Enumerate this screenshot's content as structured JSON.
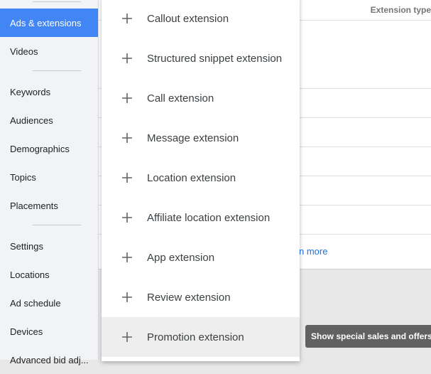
{
  "sidebar": {
    "items": [
      {
        "label": "Ads & extensions",
        "active": true
      },
      {
        "label": "Videos"
      },
      {
        "label": "Keywords"
      },
      {
        "label": "Audiences"
      },
      {
        "label": "Demographics"
      },
      {
        "label": "Topics"
      },
      {
        "label": "Placements"
      },
      {
        "label": "Settings"
      },
      {
        "label": "Locations"
      },
      {
        "label": "Ad schedule"
      },
      {
        "label": "Devices"
      },
      {
        "label": "Advanced bid adj..."
      }
    ]
  },
  "main": {
    "column_header": "Extension type",
    "learn_more": "n more"
  },
  "menu": {
    "items": [
      {
        "label": "Callout extension",
        "icon": "plus-icon"
      },
      {
        "label": "Structured snippet extension",
        "icon": "plus-icon"
      },
      {
        "label": "Call extension",
        "icon": "plus-icon"
      },
      {
        "label": "Message extension",
        "icon": "plus-icon"
      },
      {
        "label": "Location extension",
        "icon": "plus-icon"
      },
      {
        "label": "Affiliate location extension",
        "icon": "plus-icon"
      },
      {
        "label": "App extension",
        "icon": "plus-icon"
      },
      {
        "label": "Review extension",
        "icon": "plus-icon"
      },
      {
        "label": "Promotion extension",
        "icon": "plus-icon",
        "hovered": true
      }
    ]
  },
  "tooltip": {
    "text": "Show special sales and offers"
  },
  "colors": {
    "accent": "#4285f4",
    "link": "#1a73e8",
    "tooltip_bg": "#616161"
  }
}
